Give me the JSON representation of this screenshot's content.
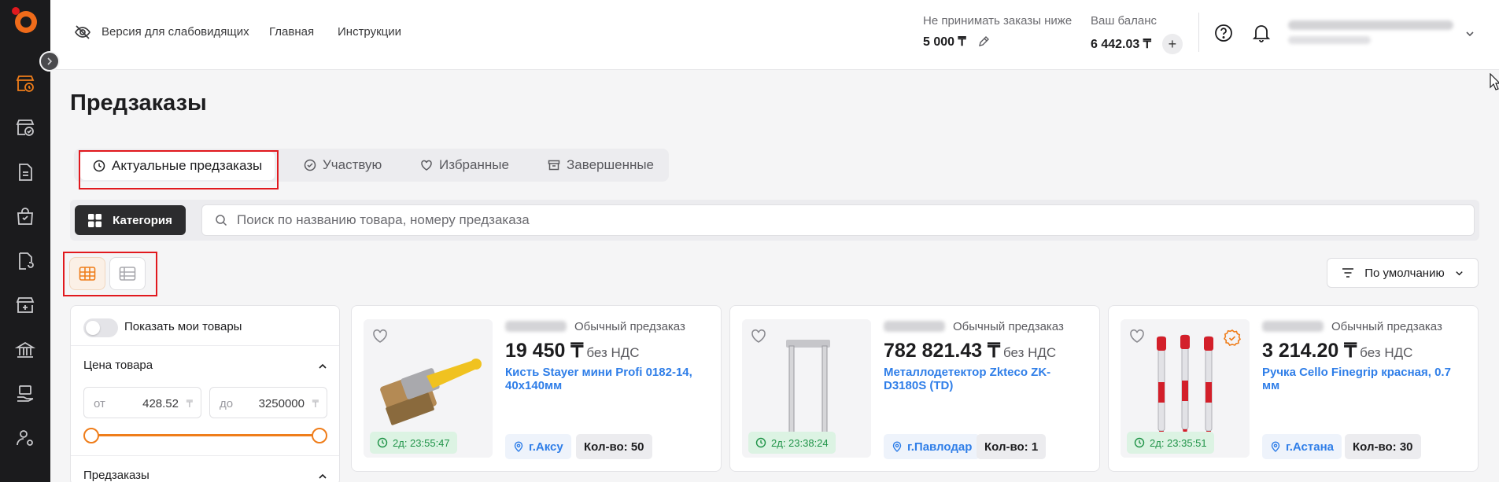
{
  "sidebar": {
    "items": [
      {
        "icon": "store-clock-icon",
        "active": true
      },
      {
        "icon": "store-check-icon",
        "active": false
      },
      {
        "icon": "document-icon",
        "active": false
      },
      {
        "icon": "shopping-bag-icon",
        "active": false
      },
      {
        "icon": "file-refresh-icon",
        "active": false
      },
      {
        "icon": "store-plus-icon",
        "active": false
      },
      {
        "icon": "bank-icon",
        "active": false
      },
      {
        "icon": "hand-cash-icon",
        "active": false
      },
      {
        "icon": "user-settings-icon",
        "active": false
      }
    ]
  },
  "header": {
    "accessibility_label": "Версия для слабовидящих",
    "nav_home": "Главная",
    "nav_instructions": "Инструкции",
    "min_orders_label": "Не принимать заказы ниже",
    "min_orders_value": "5 000 ₸",
    "balance_label": "Ваш баланс",
    "balance_value": "6 442.03 ₸",
    "plus_label": "+"
  },
  "page": {
    "title": "Предзаказы"
  },
  "tabs": [
    {
      "label": "Актуальные предзаказы",
      "icon": "clock-icon",
      "active": true
    },
    {
      "label": "Участвую",
      "icon": "check-circle-icon",
      "active": false
    },
    {
      "label": "Избранные",
      "icon": "heart-icon",
      "active": false
    },
    {
      "label": "Завершенные",
      "icon": "archive-icon",
      "active": false
    }
  ],
  "toolbar": {
    "category_label": "Категория",
    "search_placeholder": "Поиск по названию товара, номеру предзаказа",
    "sort_label": "По умолчанию",
    "view_mode": "grid"
  },
  "filters": {
    "show_my_products": "Показать мои товары",
    "price_section": "Цена товара",
    "price_from_placeholder": "от",
    "price_from_value": "428.52",
    "price_to_placeholder": "до",
    "price_to_value": "3250000",
    "currency": "₸",
    "preorders_section": "Предзаказы"
  },
  "cards": [
    {
      "type": "Обычный предзаказ",
      "price": "19 450 ₸",
      "vat": "без НДС",
      "title": "Кисть Stayer мини Profi 0182-14, 40x140мм",
      "timer": "2д: 23:55:47",
      "city": "г.Аксу",
      "qty": "Кол-во: 50",
      "verified": false
    },
    {
      "type": "Обычный предзаказ",
      "price": "782 821.43 ₸",
      "vat": "без НДС",
      "title": "Металлодетектор Zkteco ZK-D3180S (TD)",
      "timer": "2д: 23:38:24",
      "city": "г.Павлодар",
      "qty": "Кол-во: 1",
      "verified": false
    },
    {
      "type": "Обычный предзаказ",
      "price": "3 214.20 ₸",
      "vat": "без НДС",
      "title": "Ручка Cello Finegrip красная, 0.7 мм",
      "timer": "2д: 23:35:51",
      "city": "г.Астана",
      "qty": "Кол-во: 30",
      "verified": true
    }
  ],
  "colors": {
    "accent": "#ef7d1a",
    "link": "#2f7ee8",
    "sidebar_bg": "#1b1b1d",
    "timer_green": "#1f9347",
    "highlight_red": "#e1191e"
  }
}
